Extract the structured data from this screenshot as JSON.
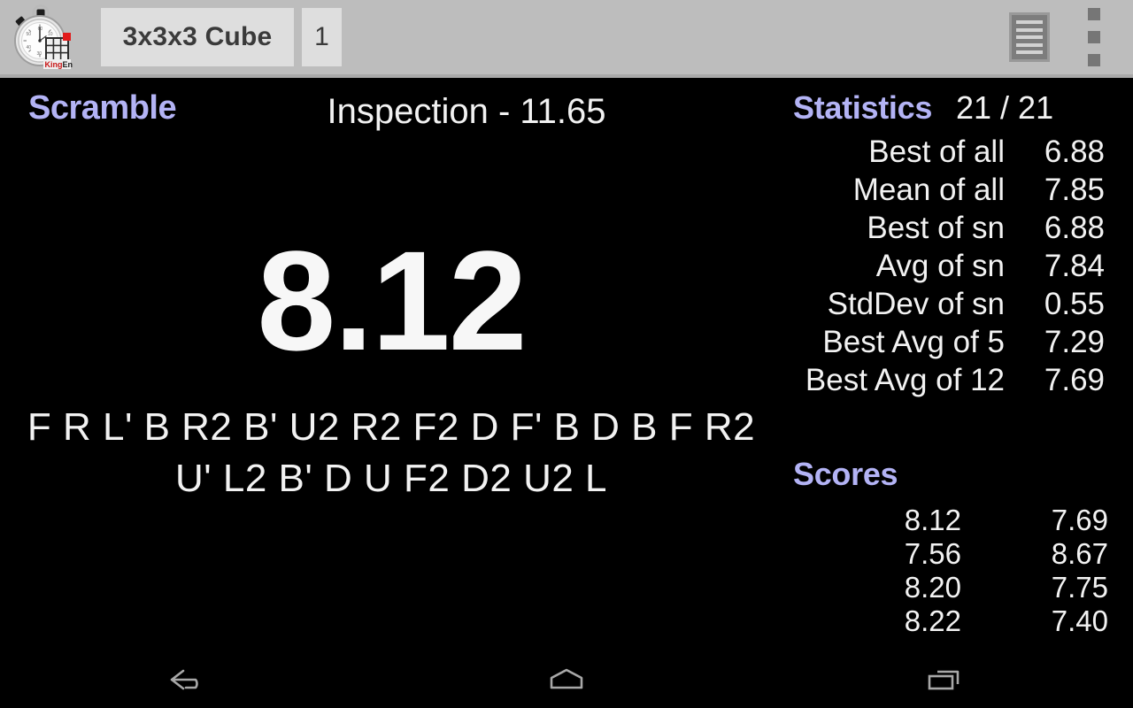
{
  "action_bar": {
    "logo_icon": "stopwatch-cube-logo",
    "logo_brand_text": "KingEn",
    "puzzle_spinner_value": "3x3x3 Cube",
    "session_spinner_value": "1",
    "list_action_icon": "list-icon",
    "overflow_action_icon": "overflow-menu-icon",
    "colors": {
      "bar_background": "#bdbdbd",
      "spinner_background": "#dedede",
      "spinner_text": "#3a3a3a"
    }
  },
  "timer_pane": {
    "scramble_heading": "Scramble",
    "inspection_label": "Inspection - 11.65",
    "big_time": "8.12",
    "scramble_lines": [
      "F R L' B R2 B' U2 R2 F2 D F' B D B F R2",
      "U' L2 B' D U F2 D2 U2 L"
    ]
  },
  "stats_pane": {
    "statistics_heading": "Statistics",
    "statistics_count": "21 / 21",
    "stats": [
      {
        "label": "Best of all",
        "value": "6.88"
      },
      {
        "label": "Mean of all",
        "value": "7.85"
      },
      {
        "label": "Best of sn",
        "value": "6.88"
      },
      {
        "label": "Avg of sn",
        "value": "7.84"
      },
      {
        "label": "StdDev of sn",
        "value": "0.55"
      },
      {
        "label": "Best Avg of 5",
        "value": "7.29"
      },
      {
        "label": "Best Avg of 12",
        "value": "7.69"
      }
    ],
    "scores_heading": "Scores",
    "scores": [
      {
        "col_a": "8.12",
        "col_b": "7.69"
      },
      {
        "col_a": "7.56",
        "col_b": "8.67"
      },
      {
        "col_a": "8.20",
        "col_b": "7.75"
      },
      {
        "col_a": "8.22",
        "col_b": "7.40"
      }
    ],
    "colors": {
      "heading": "#b3b3f5",
      "text": "#f2f2f2",
      "background": "#000000"
    }
  },
  "nav_bar": {
    "back_icon": "back-arrow-icon",
    "home_icon": "home-icon",
    "recents_icon": "recent-apps-icon"
  }
}
